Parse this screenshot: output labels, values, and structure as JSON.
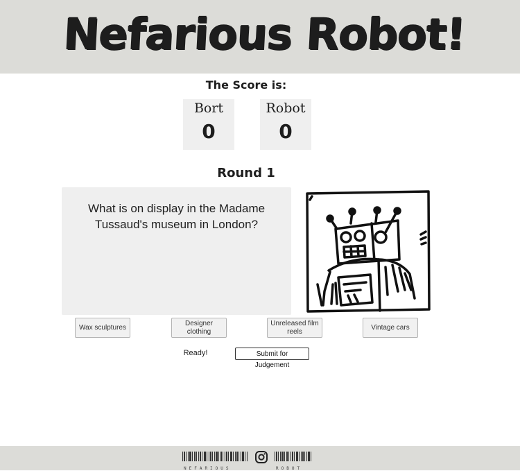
{
  "header": {
    "title": "Nefarious Robot!"
  },
  "score": {
    "heading": "The Score is:",
    "players": [
      {
        "name": "Bort",
        "value": "0"
      },
      {
        "name": "Robot",
        "value": "0"
      }
    ]
  },
  "round": {
    "label": "Round 1"
  },
  "question": {
    "text": "What is on display in the Madame Tussaud's museum in London?"
  },
  "answers": [
    {
      "label": "Wax sculptures"
    },
    {
      "label": "Designer clothing"
    },
    {
      "label": "Unreleased film reels"
    },
    {
      "label": "Vintage cars"
    }
  ],
  "status": {
    "text": "Ready!"
  },
  "submit": {
    "label": "Submit for Judgement"
  },
  "footer": {
    "left_barcode_text": "NEFARIOUS",
    "right_barcode_text": "ROBOT",
    "social_icon": "instagram-icon"
  },
  "colors": {
    "header_bg": "#dcdcd8",
    "panel_bg": "#efefef",
    "text": "#1d1d1d"
  }
}
